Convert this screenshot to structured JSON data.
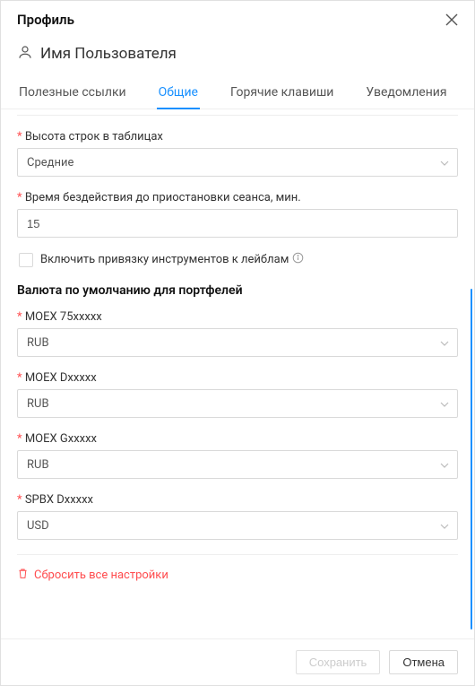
{
  "modal": {
    "title": "Профиль"
  },
  "user": {
    "name": "Имя Пользователя"
  },
  "tabs": {
    "useful_links": "Полезные ссылки",
    "general": "Общие",
    "hotkeys": "Горячие клавиши",
    "notifications": "Уведомления"
  },
  "form": {
    "row_height": {
      "label": "Высота строк в таблицах",
      "value": "Средние"
    },
    "idle_time": {
      "label": "Время бездействия до приостановки сеанса, мин.",
      "value": "15"
    },
    "binding_checkbox": {
      "label": "Включить привязку инструментов к лейблам"
    },
    "default_currency_section": "Валюта по умолчанию для портфелей",
    "portfolios": [
      {
        "label": "MOEX 75xxxxx",
        "value": "RUB"
      },
      {
        "label": "MOEX Dxxxxx",
        "value": "RUB"
      },
      {
        "label": "MOEX Gxxxxx",
        "value": "RUB"
      },
      {
        "label": "SPBX Dxxxxx",
        "value": "USD"
      }
    ],
    "reset_link": "Сбросить все настройки"
  },
  "footer": {
    "save": "Сохранить",
    "cancel": "Отмена"
  }
}
